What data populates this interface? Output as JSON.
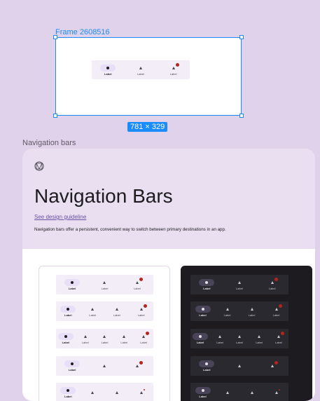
{
  "canvas": {
    "frame_label": "Frame 2608516",
    "dimensions": "781 × 329",
    "section_label": "Navigation bars"
  },
  "card": {
    "title": "Navigation Bars",
    "link": "See design guideline",
    "description": "Navigation bars offer a persistent, convenient way to switch between primary destinations in an app."
  },
  "nav": {
    "label": "Label"
  },
  "colors": {
    "selection": "#1a8cff",
    "canvas_bg": "#e0d2ea",
    "card_bg": "#eadff0",
    "active_indicator": "#e8def8",
    "badge": "#b3261e",
    "dark_panel": "#1d1b20"
  }
}
